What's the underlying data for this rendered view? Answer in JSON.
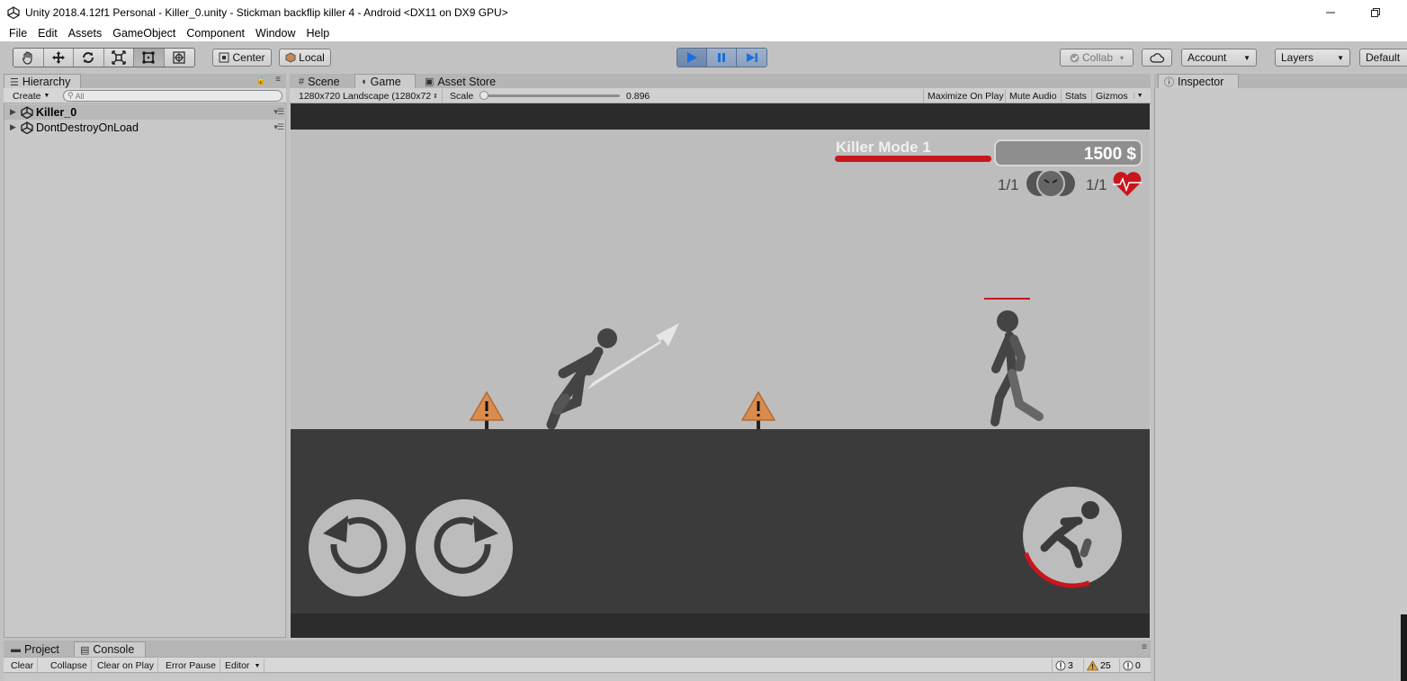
{
  "window": {
    "title": "Unity 2018.4.12f1 Personal - Killer_0.unity - Stickman backflip killer 4 - Android <DX11 on DX9 GPU>"
  },
  "menu": [
    "File",
    "Edit",
    "Assets",
    "GameObject",
    "Component",
    "Window",
    "Help"
  ],
  "toolbar": {
    "pivot_label": "Center",
    "space_label": "Local",
    "collab_label": "Collab",
    "account_label": "Account",
    "layers_label": "Layers",
    "layout_label": "Default"
  },
  "hierarchy": {
    "tab_label": "Hierarchy",
    "create_label": "Create",
    "search_placeholder": "All",
    "rows": [
      {
        "label": "Killer_0"
      },
      {
        "label": "DontDestroyOnLoad"
      }
    ]
  },
  "center_tabs": {
    "scene": "Scene",
    "game": "Game",
    "asset_store": "Asset Store"
  },
  "game_bar": {
    "resolution": "1280x720 Landscape (1280x72",
    "scale_label": "Scale",
    "scale_value": "0.896",
    "maximize": "Maximize On Play",
    "mute": "Mute Audio",
    "stats": "Stats",
    "gizmos": "Gizmos"
  },
  "game": {
    "mode_title": "Killer Mode 1",
    "money": "1500 $",
    "kills": "1/1",
    "lives": "1/1"
  },
  "inspector": {
    "tab_label": "Inspector"
  },
  "bottom": {
    "project_tab": "Project",
    "console_tab": "Console",
    "clear": "Clear",
    "collapse": "Collapse",
    "clear_on_play": "Clear on Play",
    "error_pause": "Error Pause",
    "editor": "Editor",
    "log_count": "3",
    "warning_count": "25",
    "error_count": "0"
  },
  "colors": {
    "editor_bg": "#c2c2c2",
    "sky": "#bdbdbd",
    "ground": "#3b3b3b",
    "stickman": "#444444",
    "accent_red": "#c8161d",
    "hazard": "#d98c4c"
  }
}
